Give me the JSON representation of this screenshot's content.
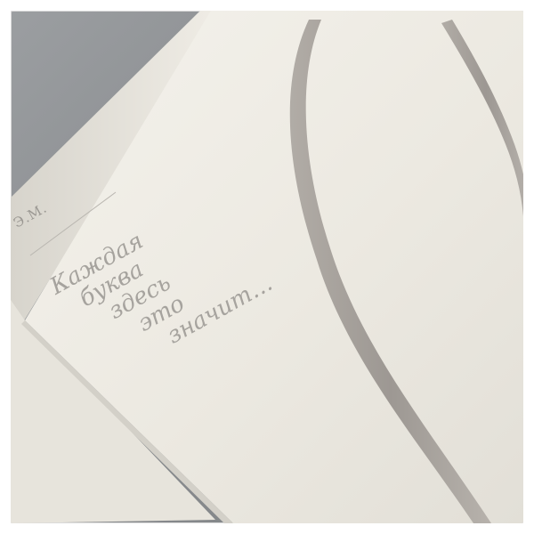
{
  "book": {
    "author": "Э.М.",
    "title_lines": [
      "Каждая",
      "буква",
      "здесь",
      "это",
      "значит…"
    ]
  },
  "colors": {
    "background": "#8f9295",
    "cover": "#eeebe3",
    "spine": "#e4e1d9",
    "text": "#9a9792",
    "stripe": "#a19c97",
    "frame": "#ffffff"
  }
}
